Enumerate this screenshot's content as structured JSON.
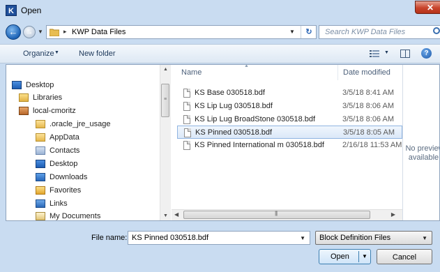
{
  "window": {
    "title": "Open",
    "app_icon_letter": "K",
    "close_glyph": "✕"
  },
  "address": {
    "path_separator": "▸",
    "path": "KWP Data Files",
    "search_placeholder": "Search KWP Data Files"
  },
  "toolbar": {
    "organize": "Organize",
    "new_folder": "New folder"
  },
  "nav": {
    "items": [
      {
        "label": "Desktop",
        "icon": "desktop-icon"
      },
      {
        "label": "Libraries",
        "icon": "libraries-icon"
      },
      {
        "label": "local-cmoritz",
        "icon": "user-folder-icon"
      },
      {
        "label": ".oracle_jre_usage",
        "icon": "folder-icon"
      },
      {
        "label": "AppData",
        "icon": "folder-icon"
      },
      {
        "label": "Contacts",
        "icon": "contacts-icon"
      },
      {
        "label": "Desktop",
        "icon": "desktop-icon"
      },
      {
        "label": "Downloads",
        "icon": "downloads-icon"
      },
      {
        "label": "Favorites",
        "icon": "favorites-icon"
      },
      {
        "label": "Links",
        "icon": "links-icon"
      },
      {
        "label": "My Documents",
        "icon": "documents-icon"
      }
    ]
  },
  "filelist": {
    "columns": {
      "name": "Name",
      "date": "Date modified"
    },
    "rows": [
      {
        "name": "KS Base 030518.bdf",
        "date": "3/5/18 8:41 AM",
        "selected": false
      },
      {
        "name": "KS Lip Lug 030518.bdf",
        "date": "3/5/18 8:06 AM",
        "selected": false
      },
      {
        "name": "KS Lip Lug BroadStone 030518.bdf",
        "date": "3/5/18 8:06 AM",
        "selected": false
      },
      {
        "name": "KS Pinned 030518.bdf",
        "date": "3/5/18 8:05 AM",
        "selected": true
      },
      {
        "name": "KS Pinned International m 030518.bdf",
        "date": "2/16/18 11:53 AM",
        "selected": false
      }
    ]
  },
  "preview": {
    "line1": "No preview",
    "line2": "available."
  },
  "bottom": {
    "filename_label": "File name:",
    "filename_value": "KS Pinned 030518.bdf",
    "filetype_value": "Block Definition Files",
    "open_label": "Open",
    "cancel_label": "Cancel"
  },
  "colors": {
    "chrome": "#c9dcf1",
    "selection_border": "#8fb4e1",
    "close_red": "#c8442b",
    "accent_blue": "#1c63b6"
  }
}
